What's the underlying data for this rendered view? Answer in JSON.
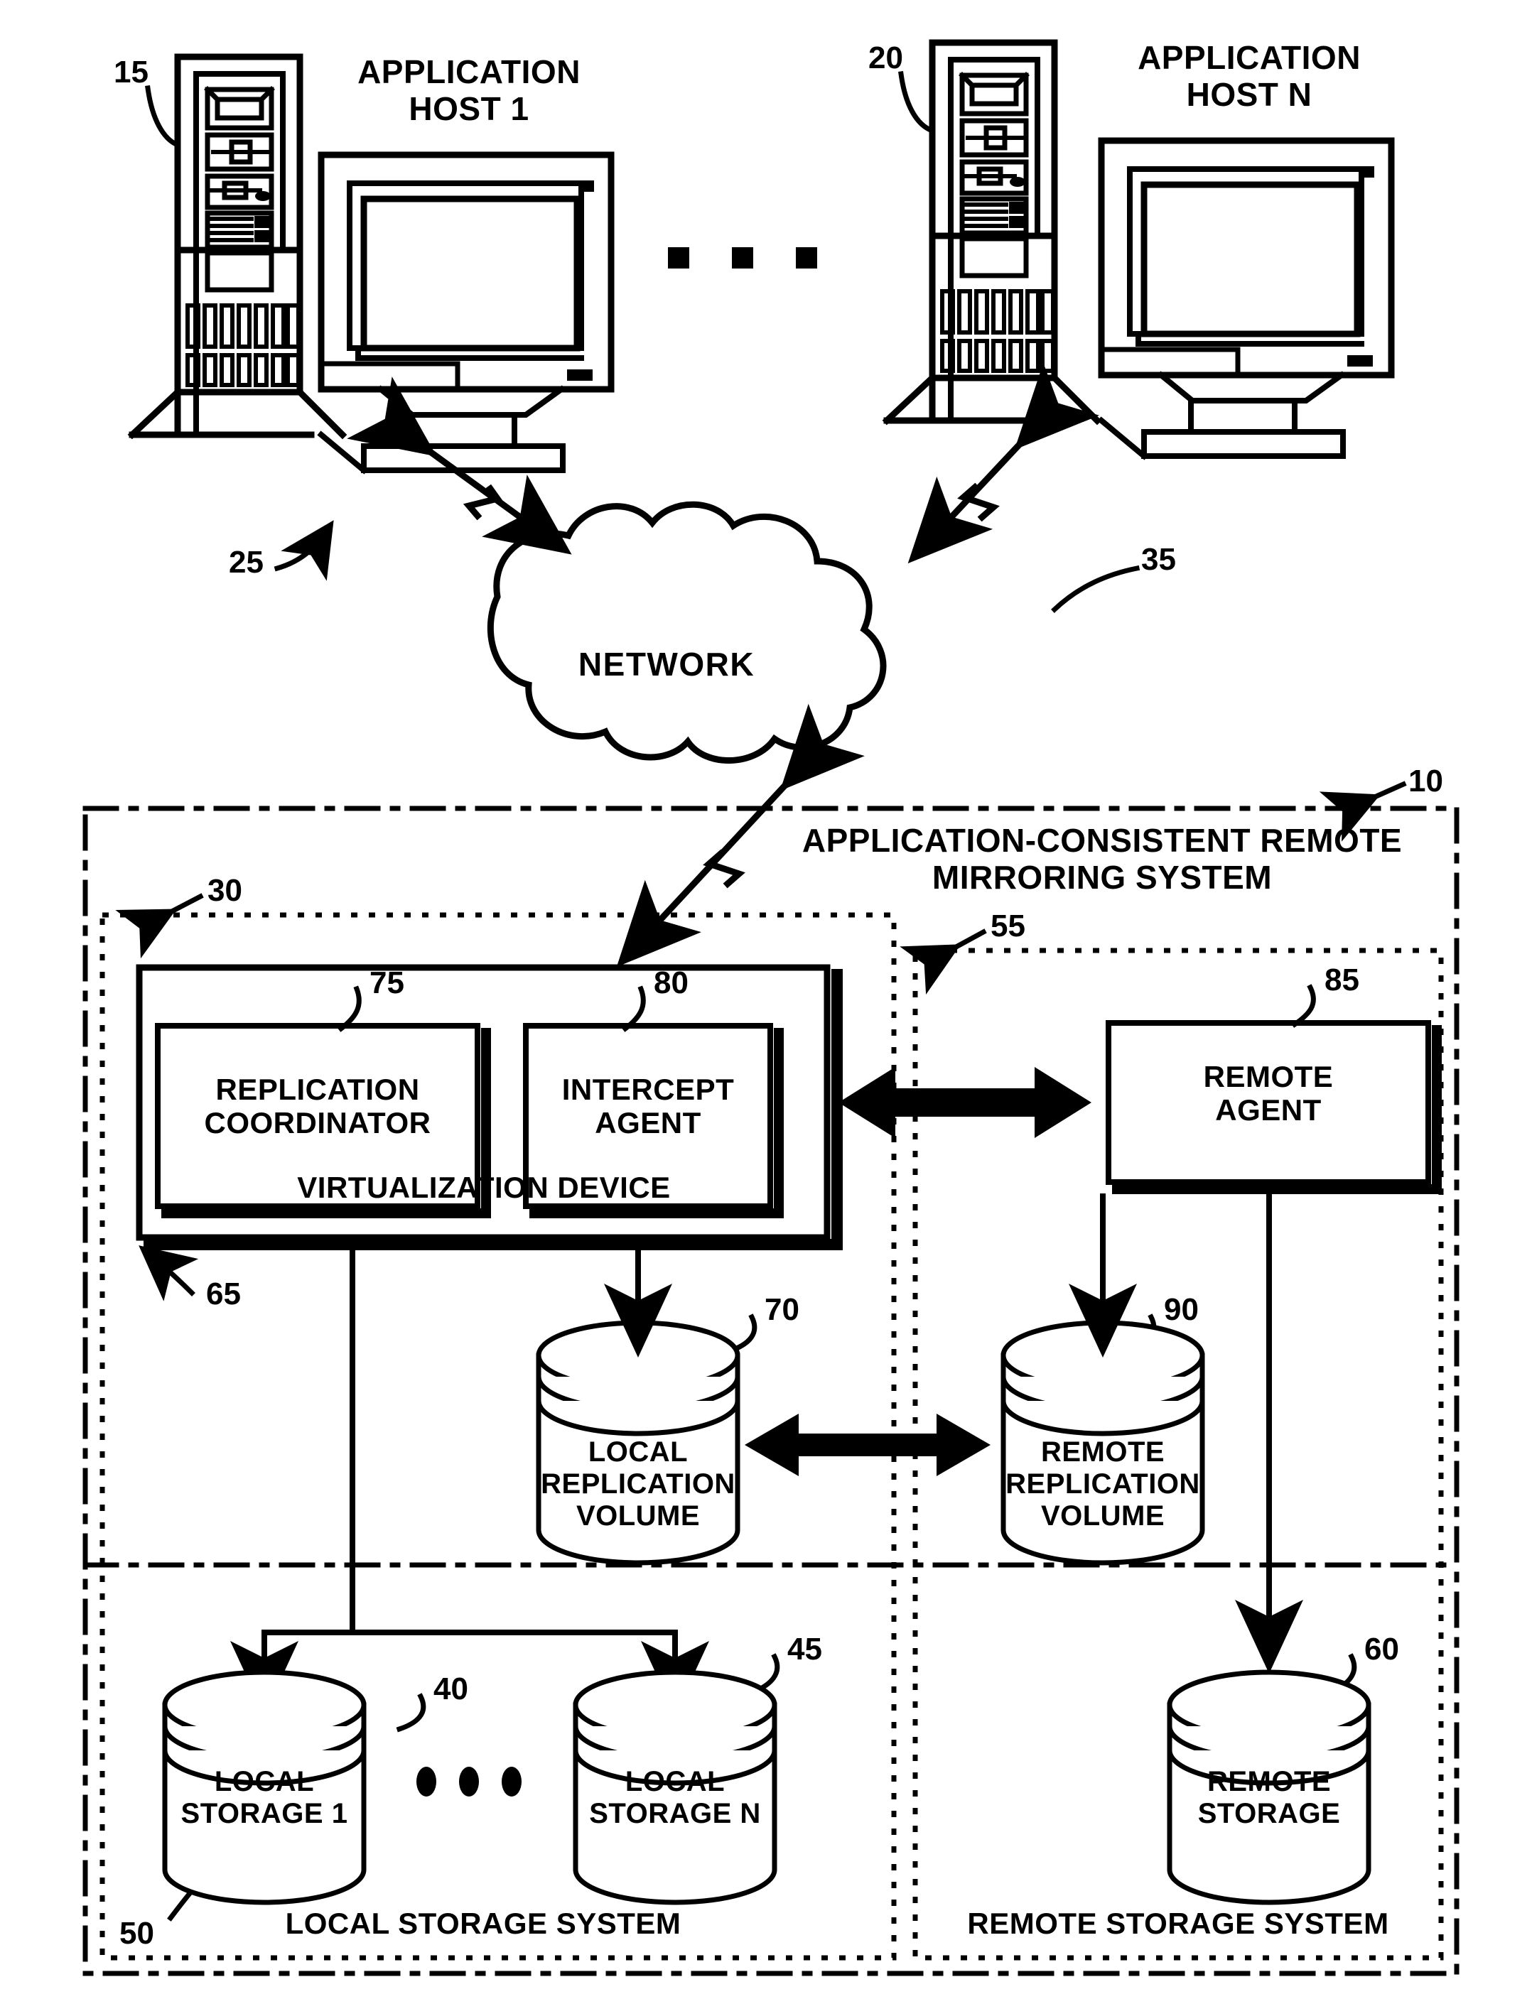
{
  "figure": {
    "type": "patent-diagram",
    "title_text": "APPLICATION-CONSISTENT REMOTE\nMIRRORING SYSTEM"
  },
  "hosts": {
    "host1": {
      "label": "APPLICATION\nHOST 1",
      "ref": "15"
    },
    "hostn": {
      "label": "APPLICATION\nHOST N",
      "ref": "20"
    },
    "ellipsis": "■ ■ ■",
    "link_ref": "25"
  },
  "network": {
    "label": "NETWORK",
    "ref": "35"
  },
  "system": {
    "ref": "10",
    "label": "APPLICATION-CONSISTENT REMOTE\nMIRRORING SYSTEM"
  },
  "local_system": {
    "ref": "30",
    "storage_ref": "50",
    "storage_label": "LOCAL STORAGE SYSTEM"
  },
  "remote_system": {
    "ref": "55",
    "storage_label": "REMOTE STORAGE SYSTEM"
  },
  "virtualization_device": {
    "label": "VIRTUALIZATION DEVICE",
    "ref": "65",
    "modules": [
      {
        "label": "REPLICATION\nCOORDINATOR",
        "ref": "75"
      },
      {
        "label": "INTERCEPT\nAGENT",
        "ref": "80"
      }
    ]
  },
  "remote_agent": {
    "label": "REMOTE\nAGENT",
    "ref": "85"
  },
  "volumes": [
    {
      "name": "local-replication-volume",
      "label": "LOCAL\nREPLICATION\nVOLUME",
      "ref": "70"
    },
    {
      "name": "remote-replication-volume",
      "label": "REMOTE\nREPLICATION\nVOLUME",
      "ref": "90"
    }
  ],
  "storage": [
    {
      "name": "local-storage-1",
      "label": "LOCAL\nSTORAGE 1",
      "ref": "40"
    },
    {
      "name": "local-storage-n",
      "label": "LOCAL\nSTORAGE N",
      "ref": "45"
    },
    {
      "name": "remote-storage",
      "label": "REMOTE\nSTORAGE",
      "ref": "60"
    }
  ],
  "storage_ellipsis": "● ● ●",
  "colors": {
    "ink": "#000000",
    "paper": "#ffffff"
  }
}
